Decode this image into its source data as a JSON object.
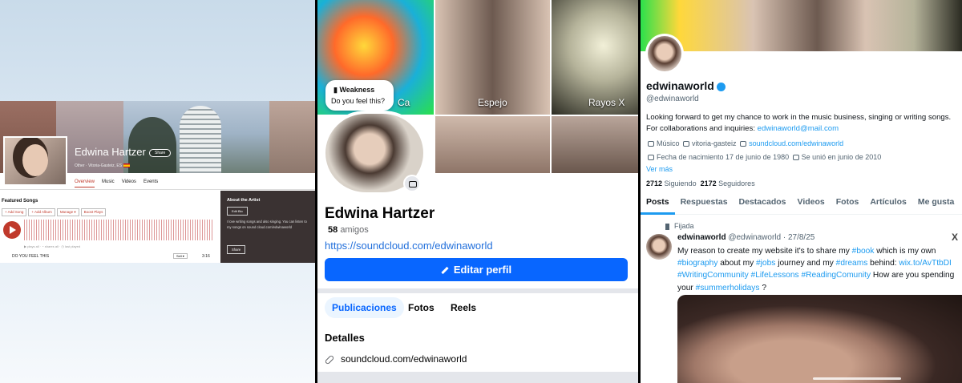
{
  "panel1": {
    "artist_name": "Edwina Hartzer",
    "share_pill": "Share",
    "meta": "Other · Vitoria-Gasteiz, ES",
    "tabs": [
      "Overview",
      "Music",
      "Videos",
      "Events"
    ],
    "featured_songs": "Featured Songs",
    "buttons": [
      "+ Add Song",
      "+ Add Album",
      "Manage ▾",
      "Boost Plays"
    ],
    "wave_meta": "▶ plays all  ·  ◔ shares all  ·  ◷ last played",
    "track": "DO YOU FEEL THIS",
    "select": "Sell ▾",
    "duration": "3:16",
    "about_title": "About the Artist",
    "about_edit": "Edit Bio",
    "about_text": "I love writing songs and also singing. You can listen to my songs on sound cloud.com/edwinaworld",
    "about_share": "Share"
  },
  "panel2": {
    "captions": [
      "Ca",
      "Espejo",
      "Rayos X"
    ],
    "bubble_title": "Weakness",
    "bubble_sub": "Do you feel this?",
    "name": "Edwina Hartzer",
    "friends_count": "58",
    "friends_label": "amigos",
    "link": "https://soundcloud.com/edwinaworld",
    "edit_button": "Editar perfil",
    "tabs": [
      "Publicaciones",
      "Fotos",
      "Reels"
    ],
    "details": "Detalles",
    "details_link": "soundcloud.com/edwinaworld"
  },
  "panel3": {
    "handle": "edwinaworld",
    "at": "@edwinaworld",
    "bio_text": "Looking forward to get my chance to work in the music business, singing or writing songs. For collaborations and inquiries: ",
    "bio_email": "edwinaworld@mail.com",
    "meta_category": "Músico",
    "meta_location": "vitoria-gasteiz",
    "meta_link": "soundcloud.com/edwinaworld",
    "meta_birth": "Fecha de nacimiento 17 de junio de 1980",
    "meta_joined": "Se unió en junio de 2010",
    "see_more": "Ver más",
    "following_count": "2712",
    "following_label": "Siguiendo",
    "followers_count": "2172",
    "followers_label": "Seguidores",
    "tabs": [
      "Posts",
      "Respuestas",
      "Destacados",
      "Videos",
      "Fotos",
      "Artículos",
      "Me gusta"
    ],
    "pinned": "Fijada",
    "tweet_name": "edwinaworld",
    "tweet_meta": "@edwinaworld · 27/8/25",
    "close": "X",
    "tweet": {
      "p1": "My reason to create my website it's to share my ",
      "h1": "#book",
      "p2": " which is my own ",
      "h2": "#biography",
      "p3": " about my ",
      "h3": "#jobs",
      "p4": " journey and my ",
      "h4": "#dreams",
      "p5": " behind: ",
      "url": "wix.to/AvTtbDI",
      "p6": " ",
      "h5": "#WritingCommunity",
      "p7": " ",
      "h6": "#LifeLessons",
      "p8": " ",
      "h7": "#ReadingComunity",
      "p9": " How are you spending your ",
      "h8": "#summerholidays",
      "p10": " ?"
    }
  }
}
